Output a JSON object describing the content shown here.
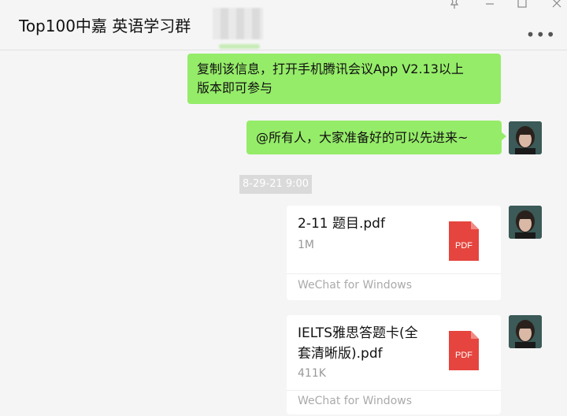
{
  "window": {
    "title": "Top100中嘉 英语学习群",
    "more_icon": "more-icon",
    "pin_icon": "pin-icon",
    "minimize_icon": "minimize-icon",
    "maximize_icon": "maximize-icon",
    "close_icon": "close-icon"
  },
  "messages": [
    {
      "type": "text",
      "sender": "self",
      "text_line1": "复制该信息，打开手机腾讯会议App V2.13以上",
      "text_line2": "版本即可参与"
    },
    {
      "type": "text",
      "sender": "self",
      "text": "@所有人，大家准备好的可以先进来~"
    }
  ],
  "timestamp": "8-29-21 9:00",
  "files": [
    {
      "name_line1": "2-11 题目.pdf",
      "name_line2": "",
      "size": "1M",
      "icon": "pdf-icon",
      "icon_label": "PDF",
      "source": "WeChat for Windows"
    },
    {
      "name_line1": "IELTS雅思答题卡(全",
      "name_line2": "套清晰版).pdf",
      "size": "411K",
      "icon": "pdf-icon",
      "icon_label": "PDF",
      "source": "WeChat for Windows"
    }
  ],
  "colors": {
    "bubble": "#95ec69",
    "pdf_red": "#e5453e",
    "background": "#f5f5f5"
  }
}
